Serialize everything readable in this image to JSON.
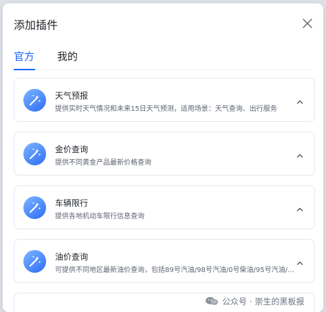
{
  "dialog": {
    "title": "添加插件"
  },
  "tabs": [
    {
      "label": "官方",
      "active": true
    },
    {
      "label": "我的",
      "active": false
    }
  ],
  "plugins": [
    {
      "name": "天气预报",
      "description": "提供实时天气情况和未来15日天气预测，适用场景：天气查询、出行服务",
      "icon": "magic-wand-icon"
    },
    {
      "name": "金价查询",
      "description": "提供不同黄金产品最新价格查询",
      "icon": "magic-wand-icon"
    },
    {
      "name": "车辆限行",
      "description": "提供各地机动车限行信息查询",
      "icon": "magic-wand-icon"
    },
    {
      "name": "油价查询",
      "description": "可提供不同地区最新油价查询，包括89号汽油/98号汽油/0号柴油/95号汽油/9...",
      "icon": "magic-wand-icon"
    }
  ],
  "watermark": {
    "text": "公众号 · 崇生的黑板报"
  },
  "colors": {
    "accent": "#1664ff",
    "icon_gradient_start": "#7db6ff",
    "icon_gradient_end": "#2d6cf6"
  }
}
